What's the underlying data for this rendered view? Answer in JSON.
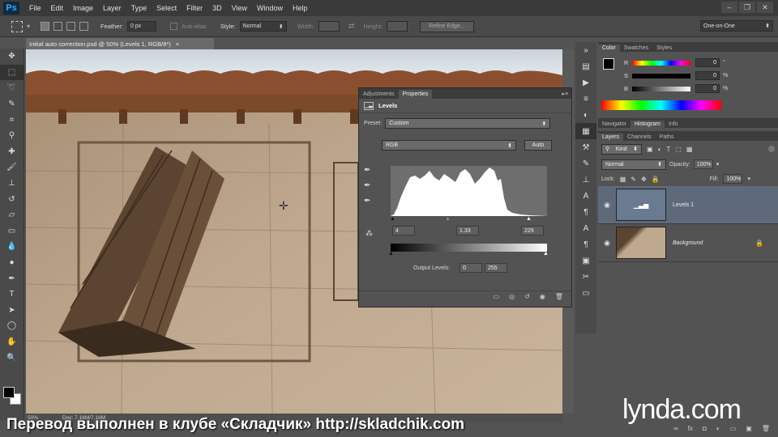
{
  "menubar": {
    "logo": "Ps",
    "items": [
      "File",
      "Edit",
      "Image",
      "Layer",
      "Type",
      "Select",
      "Filter",
      "3D",
      "View",
      "Window",
      "Help"
    ],
    "window_buttons": [
      "–",
      "❐",
      "✕"
    ]
  },
  "options": {
    "feather_label": "Feather:",
    "feather_value": "0 px",
    "antialias_label": "Anti-alias",
    "style_label": "Style:",
    "style_value": "Normal",
    "width_label": "Width:",
    "height_label": "Height:",
    "refine_edge": "Refine Edge...",
    "workspace": "One-on-One"
  },
  "document": {
    "tab_title": "Initial auto correction.psd @ 50% (Levels 1, RGB/8*)",
    "close": "×"
  },
  "status": {
    "zoom": "50%",
    "doc": "Doc: 7.16M/7.16M"
  },
  "properties": {
    "tabs": [
      "Adjustments",
      "Properties"
    ],
    "active_tab": "Properties",
    "title": "Levels",
    "preset_label": "Preset:",
    "preset_value": "Custom",
    "channel": "RGB",
    "auto_label": "Auto",
    "input_black": "4",
    "input_gamma": "1.33",
    "input_white": "229",
    "output_label": "Output Levels:",
    "output_black": "0",
    "output_white": "255"
  },
  "color_panel": {
    "tabs": [
      "Color",
      "Swatches",
      "Styles"
    ],
    "active_tab": "Color",
    "rows": [
      {
        "label": "R",
        "value": "0",
        "unit": "°"
      },
      {
        "label": "S",
        "value": "0",
        "unit": "%"
      },
      {
        "label": "B",
        "value": "0",
        "unit": "%"
      }
    ]
  },
  "nav_panel": {
    "tabs": [
      "Navigator",
      "Histogram",
      "Info"
    ],
    "active_tab": "Histogram"
  },
  "layers_panel": {
    "tabs": [
      "Layers",
      "Channels",
      "Paths"
    ],
    "active_tab": "Layers",
    "kind_label": "Kind",
    "blend_mode": "Normal",
    "opacity_label": "Opacity:",
    "opacity_value": "100%",
    "lock_label": "Lock:",
    "fill_label": "Fill:",
    "fill_value": "100%",
    "layers": [
      {
        "name": "Levels 1",
        "selected": true
      },
      {
        "name": "Background",
        "selected": false
      }
    ]
  },
  "watermark": "Перевод выполнен в клубе «Складчик» http://skladchik.com",
  "logo_text": "lynda.com"
}
